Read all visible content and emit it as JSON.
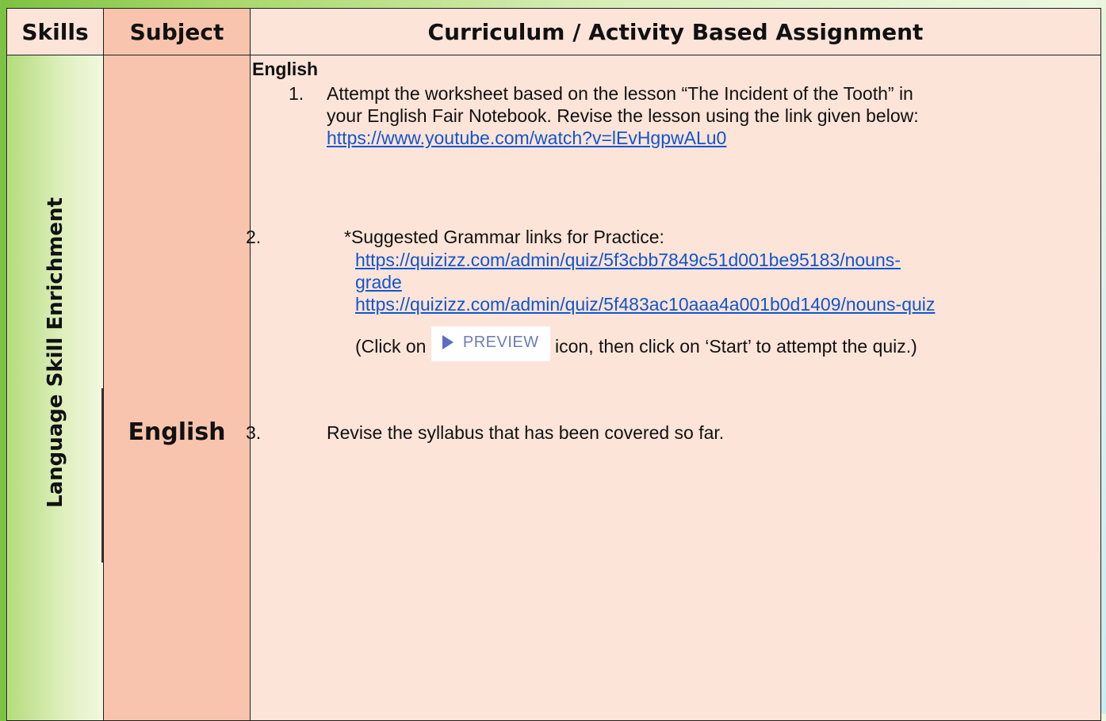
{
  "table": {
    "headers": {
      "skills": "Skills",
      "subject": "Subject",
      "curriculum": "Curriculum / Activity Based Assignment"
    },
    "skill_label": "Language Skill Enrichment",
    "subject_label": "English"
  },
  "content": {
    "heading": "English",
    "item1": {
      "number": "1.",
      "line1": "Attempt the worksheet based on the lesson “The Incident of the Tooth” in",
      "line2": "your English Fair Notebook. Revise the lesson using the link given below:",
      "link": "https://www.youtube.com/watch?v=lEvHgpwALu0"
    },
    "item2": {
      "number": "2.",
      "intro": "*Suggested Grammar links for Practice:",
      "link1_part1": "https://quizizz.com/admin/quiz/5f3cbb7849c51d001be95183/nouns-",
      "link1_part2": "grade",
      "link2": "https://quizizz.com/admin/quiz/5f483ac10aaa4a001b0d1409/nouns-quiz",
      "click_before": "(Click on",
      "preview_label": "PREVIEW",
      "click_after": "icon, then click on ‘Start’ to attempt the quiz.)"
    },
    "item3": {
      "number": "3.",
      "text": "Revise the syllabus that has been covered so far."
    }
  },
  "colors": {
    "header_light": "#fde4d8",
    "subject_bg": "#f9c4ad",
    "link": "#1155cc",
    "preview_icon": "#5b6cc7"
  }
}
